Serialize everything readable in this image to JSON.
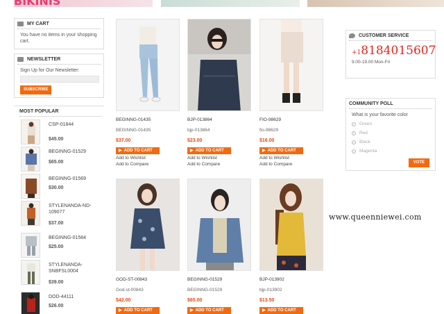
{
  "banners": {
    "first_text": "BIKINIS"
  },
  "cart": {
    "title": "MY CART",
    "message": "You have no items in your shopping cart."
  },
  "newsletter": {
    "title": "NEWSLETTER",
    "label": "Sign Up for Our Newsletter:",
    "input_value": "",
    "button": "SUBSCRIBE"
  },
  "popular": {
    "title": "MOST POPULAR",
    "items": [
      {
        "name": "CSP-01844",
        "price": "$45.00"
      },
      {
        "name": "BEGINNG-01529",
        "price": "$65.00"
      },
      {
        "name": "BEGINNG-01569",
        "price": "$30.00"
      },
      {
        "name": "STYLENANDA-ND-109077",
        "price": "$37.00"
      },
      {
        "name": "BEGINNG-01584",
        "price": "$25.00"
      },
      {
        "name": "STYLENANDA-SNBFSL0004",
        "price": "$39.00"
      },
      {
        "name": "DOD-44111",
        "price": "$26.00"
      }
    ]
  },
  "products": [
    {
      "title": "BEGINNG-01435",
      "sku": "BEGINNG-01435",
      "price": "$37.00",
      "cart": "ADD TO CART",
      "wishlist": "Add to Wishlist",
      "compare": "Add to Compare"
    },
    {
      "title": "BJP-013864",
      "sku": "bjp-013864",
      "price": "$23.00",
      "cart": "ADD TO CART",
      "wishlist": "Add to Wishlist",
      "compare": "Add to Compare"
    },
    {
      "title": "FIO-98629",
      "sku": "fio-98629",
      "price": "$16.00",
      "cart": "ADD TO CART",
      "wishlist": "Add to Wishlist",
      "compare": "Add to Compare"
    },
    {
      "title": "GOD-ST-00843",
      "sku": "God-st-00843",
      "price": "$42.00",
      "cart": "ADD TO CART"
    },
    {
      "title": "BEGINNG-01529",
      "sku": "BEGINNG-01529",
      "price": "$65.00",
      "cart": "ADD TO CART"
    },
    {
      "title": "BJP-013902",
      "sku": "bjp-013902",
      "price": "$13.50",
      "cart": "ADD TO CART"
    }
  ],
  "service": {
    "title": "CUSTOMER SERVICE",
    "plus": "+1",
    "phone": "8184015607",
    "hours": "9.00-19.00 Mon-Fri"
  },
  "poll": {
    "title": "COMMUNITY POLL",
    "question": "What is your favorite color",
    "options": [
      "Green",
      "Red",
      "Black",
      "Magenta"
    ],
    "button": "VOTE"
  },
  "watermark": "www.queenniewei.com",
  "colors": {
    "accent": "#f26a10",
    "price": "#e34c13",
    "phone": "#e0261e"
  }
}
